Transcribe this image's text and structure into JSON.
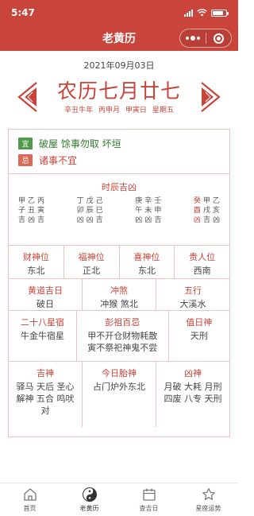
{
  "status_bar": {
    "time": "5:47"
  },
  "title_bar": {
    "title": "老黄历"
  },
  "date": {
    "gregorian": "2021年09月03日"
  },
  "lunar": {
    "main": "农历七月廿七",
    "ganzhi_year": "辛丑牛年",
    "ganzhi_month": "丙申月",
    "ganzhi_day": "甲寅日",
    "weekday": "星期五"
  },
  "yiji": {
    "yi_tag": "宜",
    "yi_text": "破屋 馀事勿取 坏垣",
    "ji_tag": "忌",
    "ji_text": "诸事不宜"
  },
  "shichen": {
    "title": "时辰吉凶",
    "groups": [
      [
        {
          "gan": "甲",
          "zhi": "子",
          "luck": "吉"
        },
        {
          "gan": "乙",
          "zhi": "丑",
          "luck": "凶"
        },
        {
          "gan": "丙",
          "zhi": "寅",
          "luck": "吉"
        }
      ],
      [
        {
          "gan": "丁",
          "zhi": "卯",
          "luck": "凶"
        },
        {
          "gan": "戊",
          "zhi": "辰",
          "luck": "凶"
        },
        {
          "gan": "己",
          "zhi": "巳",
          "luck": "吉"
        }
      ],
      [
        {
          "gan": "庚",
          "zhi": "午",
          "luck": "凶"
        },
        {
          "gan": "辛",
          "zhi": "未",
          "luck": "凶"
        },
        {
          "gan": "壬",
          "zhi": "申",
          "luck": "吉"
        }
      ],
      [
        {
          "gan": "癸",
          "zhi": "酉",
          "luck": "凶",
          "highlight": true
        },
        {
          "gan": "甲",
          "zhi": "戌",
          "luck": "吉"
        },
        {
          "gan": "乙",
          "zhi": "亥",
          "luck": "凶"
        }
      ]
    ]
  },
  "directions": {
    "cai_title": "财神位",
    "cai_value": "东北",
    "fu_title": "福神位",
    "fu_value": "正北",
    "xi_title": "喜神位",
    "xi_value": "东北",
    "gui_title": "贵人位",
    "gui_value": "西南"
  },
  "row2": {
    "huangdao_title": "黄道吉日",
    "huangdao_value": "破日",
    "chongsha_title": "冲煞",
    "chongsha_value": "冲猴 煞北",
    "wuxing_title": "五行",
    "wuxing_value": "大溪水"
  },
  "row3": {
    "xingxiu_title": "二十八星宿",
    "xingxiu_value": "牛金牛宿星",
    "pengzu_title": "彭祖百忌",
    "pengzu_line1": "甲不开仓财物耗散",
    "pengzu_line2": "寅不祭祀神鬼不尝",
    "zhishen_title": "值日神",
    "zhishen_value": "天刑"
  },
  "row4": {
    "jishen_title": "吉神",
    "jishen_line1": "驿马 天后 圣心",
    "jishen_line2": "解神 五合 鸣吠",
    "jishen_line3": "对",
    "taishen_title": "今日胎神",
    "taishen_value": "占门炉外东北",
    "xiongshen_title": "凶神",
    "xiongshen_line1": "月破 大耗 月刑",
    "xiongshen_line2": "四废 八专 天刑"
  },
  "tabs": [
    {
      "label": "首页",
      "icon": "home-icon"
    },
    {
      "label": "老黄历",
      "icon": "yin-yang-icon"
    },
    {
      "label": "查吉日",
      "icon": "calendar-icon"
    },
    {
      "label": "星座运势",
      "icon": "star-icon"
    }
  ],
  "colors": {
    "primary": "#c9443a",
    "yi": "#4e9a4a",
    "ji": "#d86a57"
  }
}
